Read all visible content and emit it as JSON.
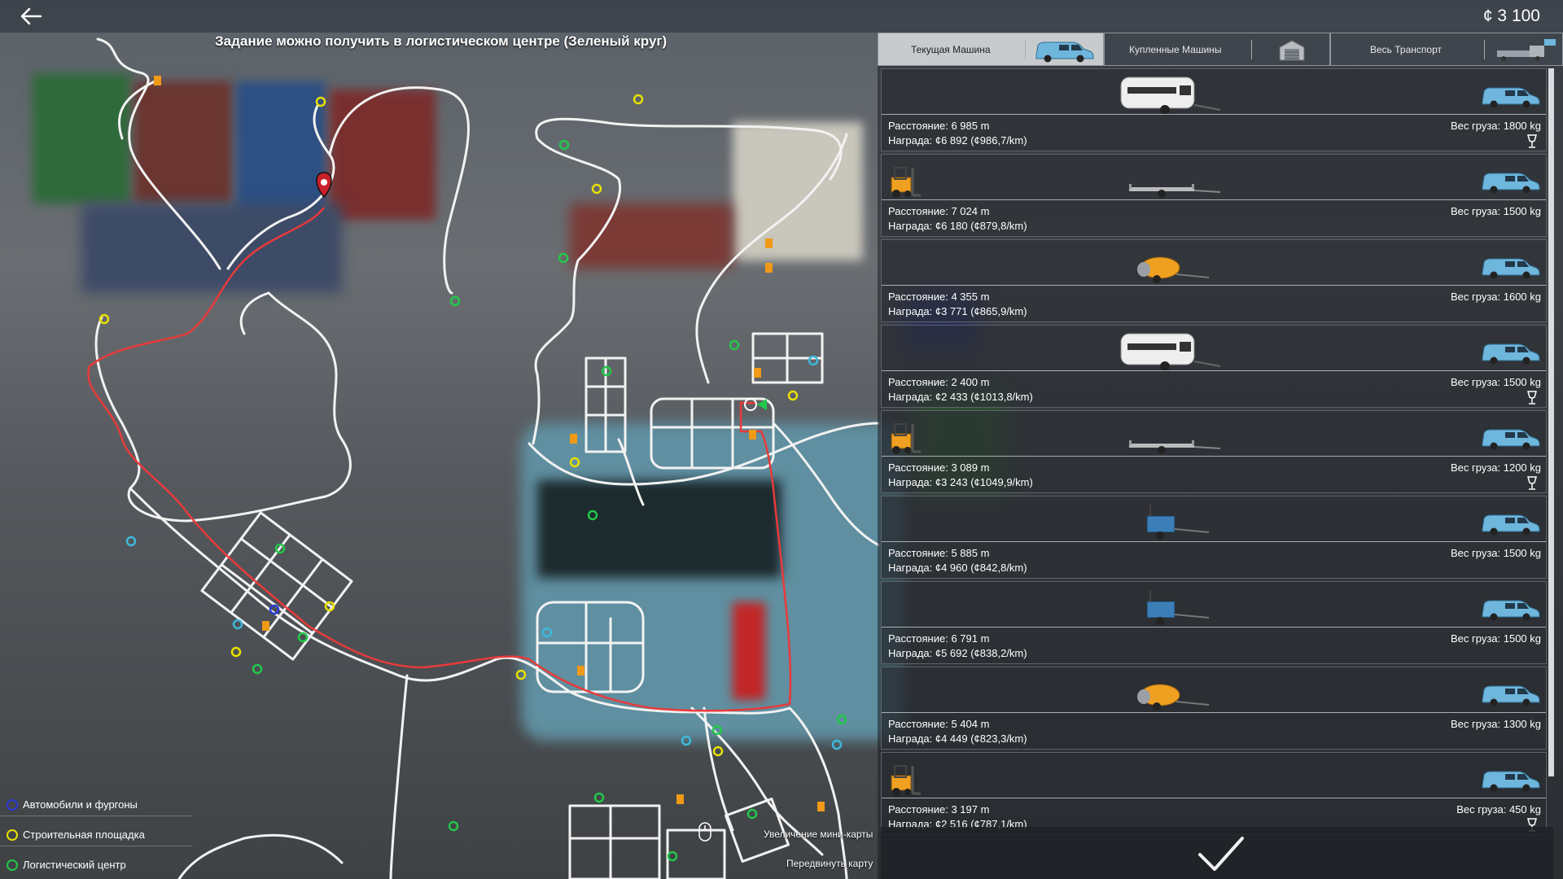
{
  "header": {
    "money": "¢ 3 100",
    "hint": "Задание можно получить в логистическом центре (Зеленый круг)"
  },
  "tabs": [
    {
      "label": "Текущая Машина",
      "active": true,
      "icon": "van-icon"
    },
    {
      "label": "Купленные Машины",
      "active": false,
      "icon": "garage-icon"
    },
    {
      "label": "Весь Транспорт",
      "active": false,
      "icon": "truck-icon"
    }
  ],
  "jobs": [
    {
      "distance": "Расстояние: 6 985 m",
      "reward": "Награда: ¢6 892 (¢986,7/km)",
      "weight": "Вес груза: 1800 kg",
      "cargo": "caravan",
      "forklift": false,
      "fragile": true
    },
    {
      "distance": "Расстояние: 7 024 m",
      "reward": "Награда: ¢6 180 (¢879,8/km)",
      "weight": "Вес груза: 1500 kg",
      "cargo": "flatbed-trailer",
      "forklift": true,
      "fragile": false
    },
    {
      "distance": "Расстояние: 4 355 m",
      "reward": "Награда: ¢3 771 (¢865,9/km)",
      "weight": "Вес груза: 1600 kg",
      "cargo": "concrete-mixer",
      "forklift": false,
      "fragile": false
    },
    {
      "distance": "Расстояние: 2 400 m",
      "reward": "Награда: ¢2 433 (¢1013,8/km)",
      "weight": "Вес груза: 1500 kg",
      "cargo": "caravan",
      "forklift": false,
      "fragile": true
    },
    {
      "distance": "Расстояние: 3 089 m",
      "reward": "Награда: ¢3 243 (¢1049,9/km)",
      "weight": "Вес груза: 1200 kg",
      "cargo": "flatbed-trailer",
      "forklift": true,
      "fragile": true
    },
    {
      "distance": "Расстояние: 5 885 m",
      "reward": "Награда: ¢4 960 (¢842,8/km)",
      "weight": "Вес груза: 1500 kg",
      "cargo": "generator-trailer",
      "forklift": false,
      "fragile": false
    },
    {
      "distance": "Расстояние: 6 791 m",
      "reward": "Награда: ¢5 692 (¢838,2/km)",
      "weight": "Вес груза: 1500 kg",
      "cargo": "generator-trailer",
      "forklift": false,
      "fragile": false
    },
    {
      "distance": "Расстояние: 5 404 m",
      "reward": "Награда: ¢4 449 (¢823,3/km)",
      "weight": "Вес груза: 1300 kg",
      "cargo": "concrete-mixer",
      "forklift": false,
      "fragile": false
    },
    {
      "distance": "Расстояние: 3 197 m",
      "reward": "Награда: ¢2 516 (¢787,1/km)",
      "weight": "Вес груза: 450 kg",
      "cargo": "none",
      "forklift": true,
      "fragile": true
    }
  ],
  "legend": [
    {
      "label": "Автомобили и фургоны",
      "color": "#2b3bd8"
    },
    {
      "label": "Строительная площадка",
      "color": "#e8e000"
    },
    {
      "label": "Логистический центр",
      "color": "#22c84a"
    }
  ],
  "controls": {
    "zoom_minimap": "Увеличение мини-карты",
    "move_map": "Передвинуть карту"
  },
  "colors": {
    "route": "#e83a3a",
    "road": "#f2f2f2",
    "active_tab": "#d7dade"
  }
}
